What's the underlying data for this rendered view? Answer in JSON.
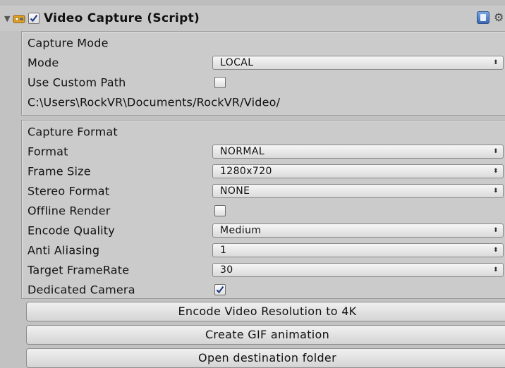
{
  "component": {
    "title": "Video Capture (Script)",
    "enabled": true
  },
  "capture_mode": {
    "header": "Capture Mode",
    "mode_label": "Mode",
    "mode_value": "LOCAL",
    "use_custom_path_label": "Use Custom Path",
    "use_custom_path": false,
    "path": "C:\\Users\\RockVR\\Documents/RockVR/Video/"
  },
  "capture_format": {
    "header": "Capture Format",
    "format_label": "Format",
    "format_value": "NORMAL",
    "frame_size_label": "Frame Size",
    "frame_size_value": "1280x720",
    "stereo_format_label": "Stereo Format",
    "stereo_format_value": "NONE",
    "offline_render_label": "Offline Render",
    "offline_render": false,
    "encode_quality_label": "Encode Quality",
    "encode_quality_value": "Medium",
    "anti_aliasing_label": "Anti Aliasing",
    "anti_aliasing_value": "1",
    "target_framerate_label": "Target FrameRate",
    "target_framerate_value": "30",
    "dedicated_camera_label": "Dedicated Camera",
    "dedicated_camera": true
  },
  "buttons": {
    "encode_4k": "Encode Video Resolution to 4K",
    "create_gif": "Create GIF animation",
    "open_folder": "Open destination folder"
  },
  "icons": {
    "foldout": "triangle-down-icon",
    "component": "script-component-icon",
    "help": "help-book-icon",
    "settings": "gear-icon"
  },
  "colors": {
    "background": "#c2c2c2",
    "checkmark": "#1f3f86"
  }
}
